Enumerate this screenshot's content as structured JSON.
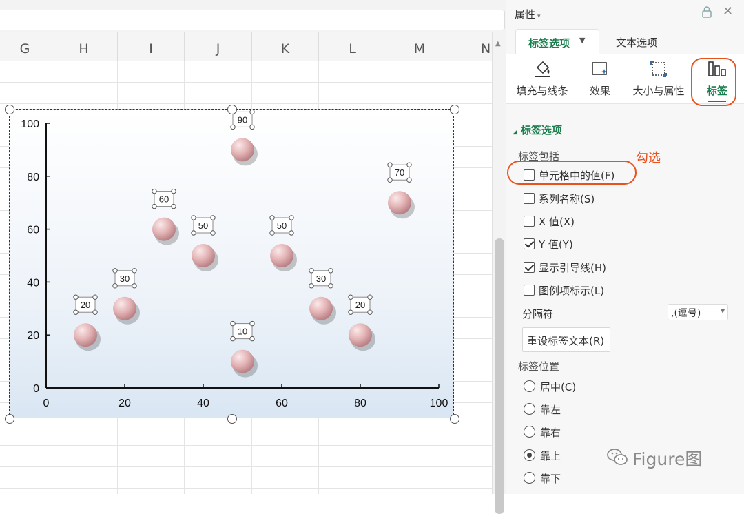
{
  "spreadsheet": {
    "columns": [
      "G",
      "H",
      "I",
      "J",
      "K",
      "L",
      "M",
      "N"
    ]
  },
  "chart_data": {
    "type": "scatter",
    "x": [
      10,
      20,
      30,
      40,
      50,
      50,
      60,
      70,
      80,
      90
    ],
    "y": [
      20,
      30,
      60,
      50,
      90,
      10,
      50,
      30,
      20,
      70
    ],
    "data_labels": [
      "20",
      "30",
      "60",
      "50",
      "90",
      "10",
      "50",
      "30",
      "20",
      "70"
    ],
    "xlim": [
      0,
      100
    ],
    "ylim": [
      0,
      100
    ],
    "xticks": [
      "0",
      "20",
      "40",
      "60",
      "80",
      "100"
    ],
    "yticks": [
      "0",
      "20",
      "40",
      "60",
      "80",
      "100"
    ],
    "grid": false,
    "legend": "none",
    "marker_color": "#e3b3b5"
  },
  "panel": {
    "title": "属性",
    "tabs": {
      "active": "标签选项",
      "other": "文本选项"
    },
    "toolbar": [
      {
        "label": "填充与线条",
        "icon": "fill-line-icon"
      },
      {
        "label": "效果",
        "icon": "effects-icon"
      },
      {
        "label": "大小与属性",
        "icon": "size-properties-icon"
      },
      {
        "label": "标签",
        "icon": "label-icon"
      }
    ],
    "section_title": "标签选项",
    "include_label": "标签包括",
    "options": [
      {
        "label": "单元格中的值(F)",
        "checked": false
      },
      {
        "label": "系列名称(S)",
        "checked": false
      },
      {
        "label": "X 值(X)",
        "checked": false
      },
      {
        "label": "Y 值(Y)",
        "checked": true
      },
      {
        "label": "显示引导线(H)",
        "checked": true
      },
      {
        "label": "图例项标示(L)",
        "checked": false
      }
    ],
    "separator_label": "分隔符",
    "separator_value": ",(逗号)",
    "reset_button": "重设标签文本(R)",
    "position_label": "标签位置",
    "positions": [
      {
        "label": "居中(C)",
        "checked": false
      },
      {
        "label": "靠左",
        "checked": false
      },
      {
        "label": "靠右",
        "checked": false
      },
      {
        "label": "靠上",
        "checked": true
      },
      {
        "label": "靠下",
        "checked": false
      }
    ]
  },
  "annotation": "勾选",
  "watermark": "Figure图",
  "colors": {
    "accent_green": "#1a7d4d",
    "annotation_orange": "#e8521d"
  }
}
